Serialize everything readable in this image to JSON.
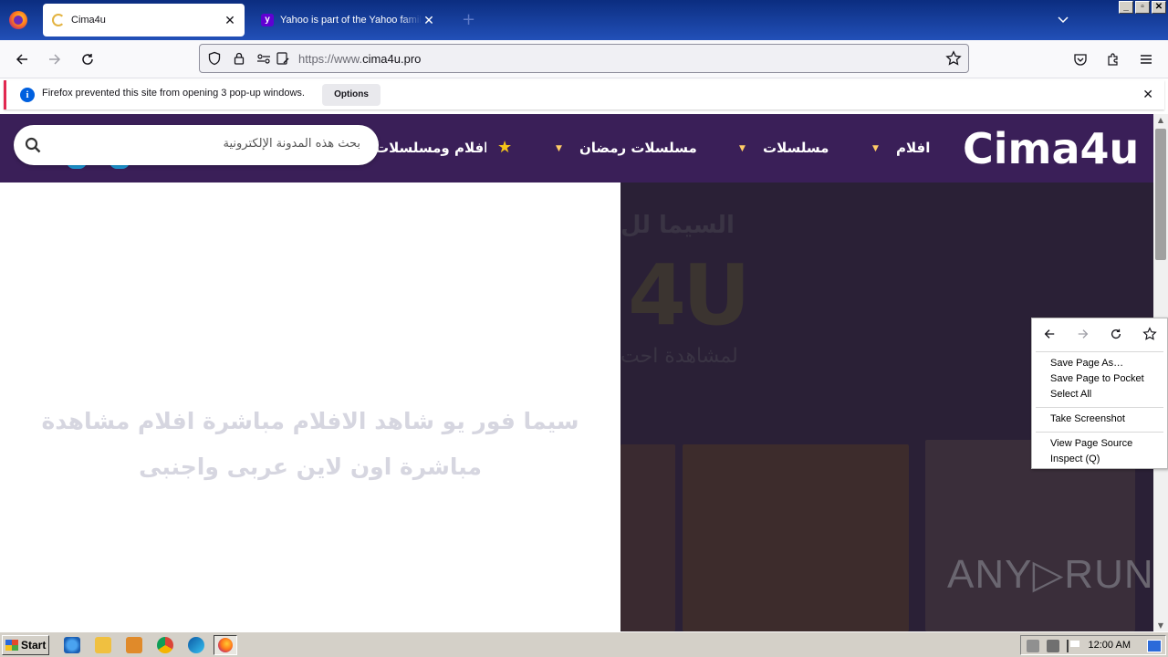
{
  "browser": {
    "tabs": [
      {
        "title": "Cima4u",
        "active": true
      },
      {
        "title": "Yahoo is part of the Yahoo family of brands",
        "active": false
      }
    ],
    "url": {
      "prefix": "https://www.",
      "domain": "cima4u.pro"
    },
    "window_buttons": [
      "_",
      "▫",
      "✕"
    ]
  },
  "notification": {
    "message": "Firefox prevented this site from opening 3 pop-up windows.",
    "options_label": "Options"
  },
  "site": {
    "logo": "Cima4u",
    "menu": [
      {
        "label": "افلام"
      },
      {
        "label": "مسلسلات"
      },
      {
        "label": "مسلسلات رمضان"
      },
      {
        "label": "افلام ومسلسلات"
      }
    ],
    "search_placeholder": "بحث هذه المدونة الإلكترونية",
    "tagline": "سيما فور يو شاهد الافلام مباشرة افلام مشاهدة مباشرة اون لاين عربى واجنبى",
    "hero": {
      "heading": "السيما لل",
      "big_text": "4U",
      "subheading": "لمشاهدة احت"
    },
    "watermark": "ANY▷RUN"
  },
  "context_menu": {
    "items": [
      "Save Page As…",
      "Save Page to Pocket",
      "Select All",
      "Take Screenshot",
      "View Page Source",
      "Inspect (Q)"
    ]
  },
  "taskbar": {
    "start_label": "Start",
    "clock": "12:00 AM"
  }
}
